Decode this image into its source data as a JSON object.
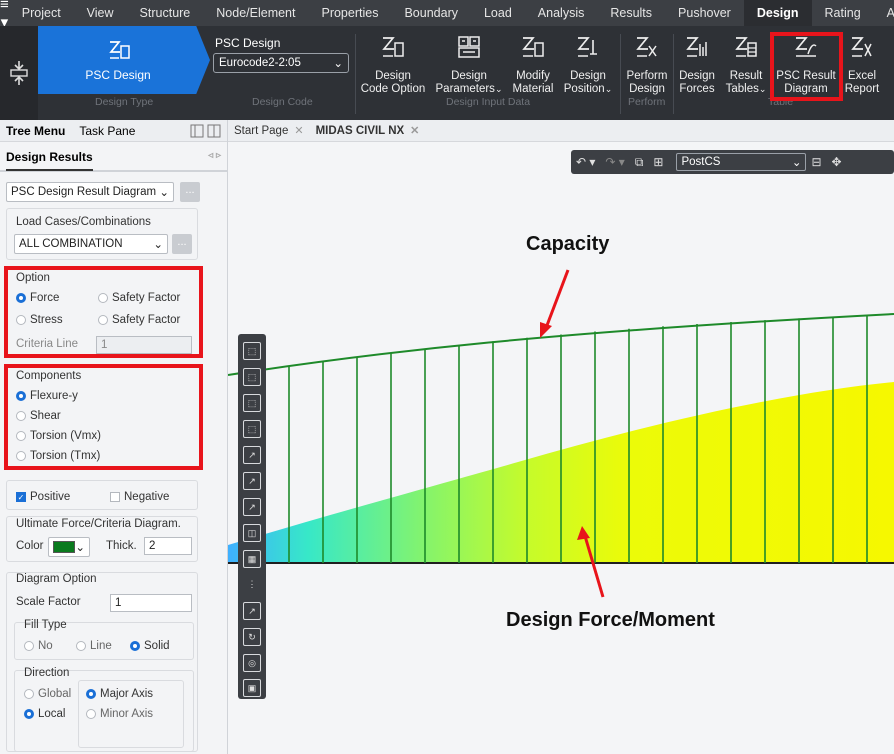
{
  "menu": {
    "hamburger": "≡ ▾",
    "items": [
      "Project",
      "View",
      "Structure",
      "Node/Element",
      "Properties",
      "Boundary",
      "Load",
      "Analysis",
      "Results",
      "Pushover",
      "Design",
      "Rating",
      "Apps"
    ],
    "active": "Design"
  },
  "ribbon": {
    "design_type": {
      "label": "PSC Design",
      "group": "Design Type"
    },
    "design_code": {
      "title": "PSC Design",
      "selected": "Eurocode2-2:05",
      "group": "Design Code"
    },
    "design_input": {
      "group": "Design Input Data",
      "buttons": [
        {
          "line1": "Design",
          "line2": "Code Option"
        },
        {
          "line1": "Design",
          "line2": "Parameters"
        },
        {
          "line1": "Modify",
          "line2": "Material"
        },
        {
          "line1": "Design",
          "line2": "Position"
        }
      ]
    },
    "perform": {
      "group": "Perform",
      "buttons": [
        {
          "line1": "Perform",
          "line2": "Design"
        }
      ]
    },
    "table": {
      "group": "Table",
      "buttons": [
        {
          "line1": "Design",
          "line2": "Forces"
        },
        {
          "line1": "Result",
          "line2": "Tables"
        },
        {
          "line1": "PSC Result",
          "line2": "Diagram"
        },
        {
          "line1": "Excel",
          "line2": "Report"
        }
      ]
    }
  },
  "left_panel": {
    "tabs": [
      "Tree Menu",
      "Task Pane"
    ],
    "title": "Design Results",
    "result_type": "PSC Design Result Diagram",
    "load_cases": {
      "label": "Load Cases/Combinations",
      "selected": "ALL COMBINATION"
    },
    "option": {
      "label": "Option",
      "force": "Force",
      "stress": "Stress",
      "safety_factor_1": "Safety Factor",
      "safety_factor_2": "Safety Factor",
      "criteria_line_label": "Criteria Line",
      "criteria_line_value": "1"
    },
    "components": {
      "label": "Components",
      "items": [
        "Flexure-y",
        "Shear",
        "Torsion (Vmx)",
        "Torsion (Tmx)"
      ]
    },
    "positive": "Positive",
    "negative": "Negative",
    "ultimate": {
      "label": "Ultimate Force/Criteria Diagram.",
      "color_label": "Color",
      "color": "#0a7a1e",
      "thick_label": "Thick.",
      "thick_value": "2"
    },
    "diagram_option": {
      "label": "Diagram Option",
      "scale_factor_label": "Scale Factor",
      "scale_factor_value": "1",
      "fill_type_label": "Fill Type",
      "fill_no": "No",
      "fill_line": "Line",
      "fill_solid": "Solid",
      "direction_label": "Direction",
      "global": "Global",
      "local": "Local",
      "major_axis": "Major Axis",
      "minor_axis": "Minor Axis"
    }
  },
  "doc_tabs": [
    "Start Page",
    "MIDAS CIVIL NX"
  ],
  "viewport": {
    "stage_selected": "PostCS",
    "annotation_capacity": "Capacity",
    "annotation_force": "Design Force/Moment"
  },
  "colors": {
    "accent_blue": "#1a73d9",
    "highlight_red": "#e8141b",
    "capacity_green": "#1e8a2a",
    "force_yellow": "#f4f800"
  }
}
